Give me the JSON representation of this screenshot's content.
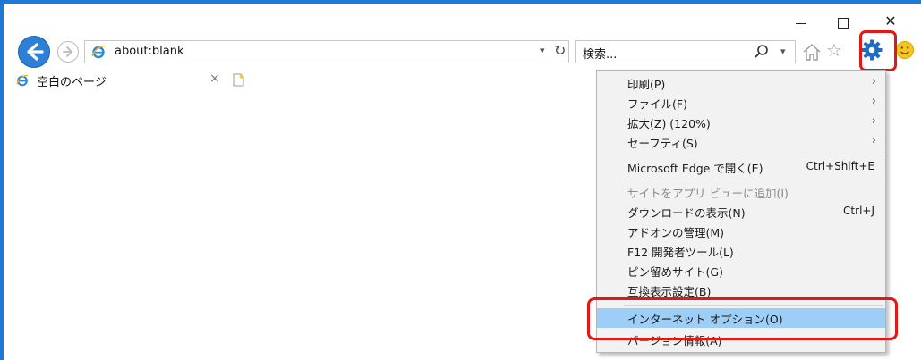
{
  "window": {
    "minimize": "—",
    "maximize": "☐",
    "close": "✕"
  },
  "toolbar": {
    "address": "about:blank",
    "address_dropdown": "▾",
    "refresh": "↻",
    "search_placeholder": "検索...",
    "search_dropdown": "▾",
    "star": "☆"
  },
  "tab": {
    "title": "空白のページ",
    "close": "×"
  },
  "menu": {
    "items": [
      {
        "label": "印刷(P)",
        "arrow": "›"
      },
      {
        "label": "ファイル(F)",
        "arrow": "›"
      },
      {
        "label": "拡大(Z) (120%)",
        "arrow": "›"
      },
      {
        "label": "セーフティ(S)",
        "arrow": "›"
      },
      {
        "label": "Microsoft Edge で開く(E)",
        "shortcut": "Ctrl+Shift+E"
      },
      {
        "label": "サイトをアプリ ビューに追加(I)"
      },
      {
        "label": "ダウンロードの表示(N)",
        "shortcut": "Ctrl+J"
      },
      {
        "label": "アドオンの管理(M)"
      },
      {
        "label": "F12 開発者ツール(L)"
      },
      {
        "label": "ピン留めサイト(G)"
      },
      {
        "label": "互換表示設定(B)"
      },
      {
        "label": "インターネット オプション(O)"
      },
      {
        "label": "バージョン情報(A)"
      }
    ]
  },
  "colors": {
    "highlight": "#e01818",
    "selected": "#9ecdf6",
    "accent": "#2e7fd6"
  }
}
